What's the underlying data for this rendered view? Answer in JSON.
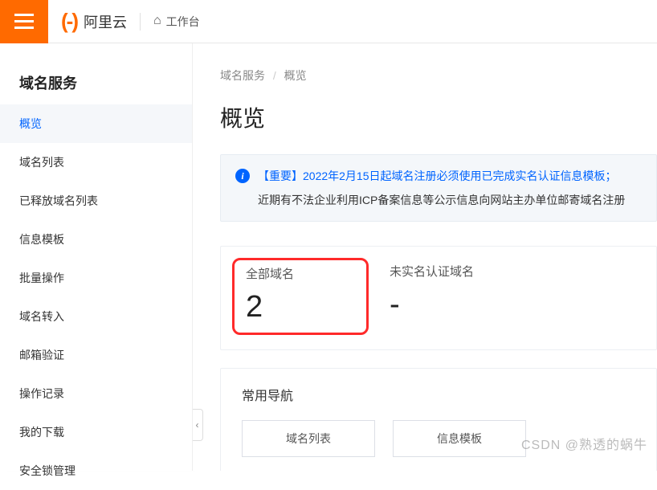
{
  "header": {
    "logo_text": "阿里云",
    "workspace_label": "工作台"
  },
  "sidebar": {
    "title": "域名服务",
    "items": [
      {
        "label": "概览",
        "active": true
      },
      {
        "label": "域名列表",
        "active": false
      },
      {
        "label": "已释放域名列表",
        "active": false
      },
      {
        "label": "信息模板",
        "active": false
      },
      {
        "label": "批量操作",
        "active": false
      },
      {
        "label": "域名转入",
        "active": false
      },
      {
        "label": "邮箱验证",
        "active": false
      },
      {
        "label": "操作记录",
        "active": false
      },
      {
        "label": "我的下载",
        "active": false
      },
      {
        "label": "安全锁管理",
        "active": false
      }
    ]
  },
  "breadcrumb": {
    "root": "域名服务",
    "current": "概览"
  },
  "page_title": "概览",
  "alert": {
    "line1": "【重要】2022年2月15日起域名注册必须使用已完成实名认证信息模板；",
    "line2": "近期有不法企业利用ICP备案信息等公示信息向网站主办单位邮寄域名注册"
  },
  "stats": {
    "total_domains": {
      "label": "全部域名",
      "value": "2"
    },
    "unverified": {
      "label": "未实名认证域名",
      "value": "-"
    }
  },
  "quick_nav": {
    "title": "常用导航",
    "buttons": [
      {
        "label": "域名列表"
      },
      {
        "label": "信息模板"
      }
    ]
  },
  "watermark": "CSDN @熟透的蜗牛"
}
